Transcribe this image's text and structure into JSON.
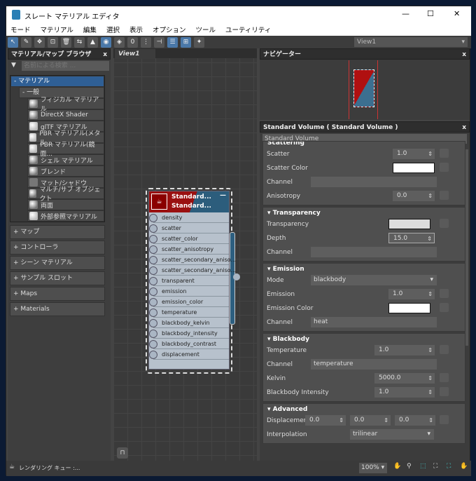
{
  "window": {
    "title": "スレート マテリアル エディタ",
    "minimize": "—",
    "maximize": "☐",
    "close": "✕"
  },
  "menu": [
    "モード",
    "マテリアル",
    "編集",
    "選択",
    "表示",
    "オプション",
    "ツール",
    "ユーティリティ"
  ],
  "toolbar": {
    "view_select": "View1"
  },
  "browser": {
    "title": "マテリアル/マップ ブラウザ",
    "close": "x",
    "search_placeholder": "名前による検索 ...",
    "group": "- マテリアル",
    "subgroup": "- 一般",
    "materials": [
      {
        "label": "フィジカル マテリアル",
        "b": ""
      },
      {
        "label": "DirectX Shader",
        "b": ""
      },
      {
        "label": "glTF マテリアル",
        "b": "w"
      },
      {
        "label": "PBR マテリアル(メタル ...",
        "b": "w"
      },
      {
        "label": "PBR マテリアル(鏡面...",
        "b": "w"
      },
      {
        "label": "シェル マテリアル",
        "b": ""
      },
      {
        "label": "ブレンド",
        "b": ""
      },
      {
        "label": "マット/シャドウ",
        "b": "f"
      },
      {
        "label": "マルチ/サブ オブジェクト",
        "b": ""
      },
      {
        "label": "両面",
        "b": ""
      },
      {
        "label": "外部参照マテリアル",
        "b": "w"
      }
    ],
    "categories": [
      "+ マップ",
      "+ コントローラ",
      "+ シーン マテリアル",
      "+ サンプル スロット",
      "+ Maps",
      "+ Materials"
    ]
  },
  "view": {
    "tab": "View1"
  },
  "node": {
    "title1": "Standard...",
    "title2": "Standard...",
    "ports": [
      "density",
      "scatter",
      "scatter_color",
      "scatter_anisotropy",
      "scatter_secondary_aniso...",
      "scatter_secondary_aniso...",
      "transparent",
      "emission",
      "emission_color",
      "temperature",
      "blackbody_kelvin",
      "blackbody_intensity",
      "blackbody_contrast",
      "displacement"
    ]
  },
  "navigator": {
    "title": "ナビゲーター",
    "close": "x"
  },
  "props": {
    "title": "Standard Volume  ( Standard Volume )",
    "close": "x",
    "name": "Standard Volume",
    "scattering": {
      "header": "Scattering",
      "scatter_label": "Scatter",
      "scatter": "1.0",
      "color_label": "Scatter Color",
      "channel_label": "Channel",
      "aniso_label": "Anisotropy",
      "aniso": "0.0"
    },
    "transparency": {
      "header": "Transparency",
      "label": "Transparency",
      "depth_label": "Depth",
      "depth": "15.0",
      "channel_label": "Channel"
    },
    "emission": {
      "header": "Emission",
      "mode_label": "Mode",
      "mode": "blackbody",
      "emission_label": "Emission",
      "emission": "1.0",
      "color_label": "Emission Color",
      "channel_label": "Channel",
      "channel": "heat"
    },
    "blackbody": {
      "header": "Blackbody",
      "temp_label": "Temperature",
      "temp": "1.0",
      "channel_label": "Channel",
      "channel": "temperature",
      "kelvin_label": "Kelvin",
      "kelvin": "5000.0",
      "intensity_label": "Blackbody Intensity",
      "intensity": "1.0"
    },
    "advanced": {
      "header": "Advanced",
      "disp_label": "Displacement",
      "disp": [
        "0.0",
        "0.0",
        "0.0"
      ],
      "interp_label": "Interpolation",
      "interp": "trilinear"
    }
  },
  "status": {
    "text": "レンダリング キュー :...",
    "zoom": "100%"
  }
}
